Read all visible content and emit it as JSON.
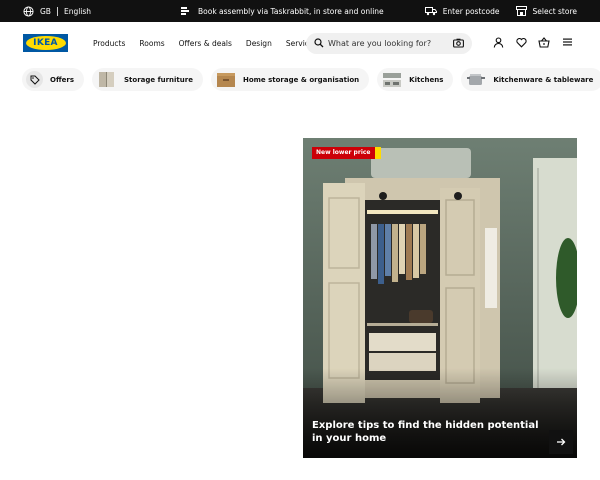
{
  "topbar": {
    "country": "GB",
    "language": "English",
    "promo": "Book assembly via Taskrabbit, in store and online",
    "postcode": "Enter postcode",
    "store": "Select store"
  },
  "header": {
    "logo_text": "IKEA",
    "nav": [
      "Products",
      "Rooms",
      "Offers & deals",
      "Design",
      "Services"
    ],
    "search_placeholder": "What are you looking for?"
  },
  "categories": [
    {
      "label": "Offers",
      "icon": "tag-icon"
    },
    {
      "label": "Storage furniture",
      "icon": "wardrobe-thumbnail"
    },
    {
      "label": "Home storage & organisation",
      "icon": "box-thumbnail"
    },
    {
      "label": "Kitchens",
      "icon": "kitchen-thumbnail"
    },
    {
      "label": "Kitchenware & tableware",
      "icon": "pot-thumbnail"
    }
  ],
  "feature": {
    "badge": "New lower price",
    "title": "Explore tips to find the hidden potential in your home"
  },
  "colors": {
    "brand_blue": "#0058a3",
    "brand_yellow": "#ffdb00",
    "price_red": "#cc0008"
  }
}
